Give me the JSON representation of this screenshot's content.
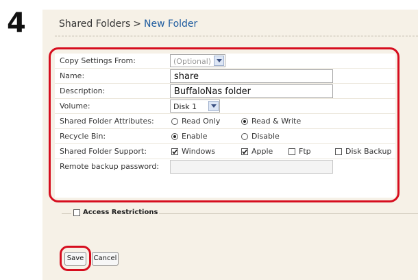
{
  "step_number": "4",
  "breadcrumb": {
    "parent": "Shared Folders",
    "separator": ">",
    "current": "New Folder"
  },
  "form": {
    "copy_settings": {
      "label": "Copy Settings From:",
      "value": "(Optional)"
    },
    "name": {
      "label": "Name:",
      "value": "share"
    },
    "description": {
      "label": "Description:",
      "value": "BuffaloNas folder"
    },
    "volume": {
      "label": "Volume:",
      "value": "Disk 1"
    },
    "attributes": {
      "label": "Shared Folder Attributes:",
      "options": [
        {
          "label": "Read Only",
          "selected": false
        },
        {
          "label": "Read & Write",
          "selected": true
        }
      ]
    },
    "recycle_bin": {
      "label": "Recycle Bin:",
      "options": [
        {
          "label": "Enable",
          "selected": true
        },
        {
          "label": "Disable",
          "selected": false
        }
      ]
    },
    "support": {
      "label": "Shared Folder Support:",
      "options": [
        {
          "label": "Windows",
          "checked": true
        },
        {
          "label": "Apple",
          "checked": true
        },
        {
          "label": "Ftp",
          "checked": false
        },
        {
          "label": "Disk Backup",
          "checked": false
        }
      ]
    },
    "remote_backup_password": {
      "label": "Remote backup password:",
      "value": ""
    }
  },
  "access_restrictions": {
    "label": "Access Restrictions",
    "checked": false
  },
  "buttons": {
    "save": "Save",
    "cancel": "Cancel"
  },
  "colors": {
    "panel_background": "#f6f1e7",
    "highlight": "#d60d1e",
    "link": "#1c5a9e"
  }
}
